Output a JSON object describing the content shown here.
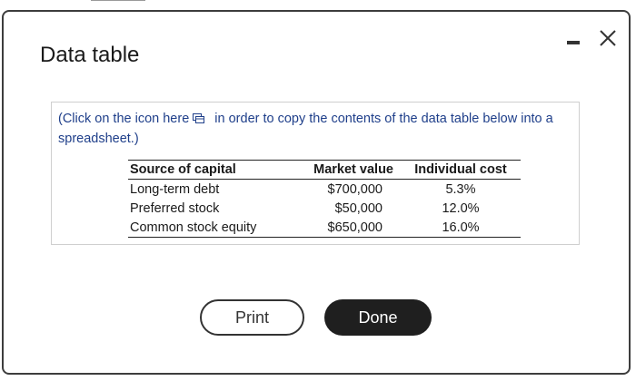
{
  "dialog": {
    "title": "Data table",
    "instructions_before_icon": "(Click on the icon  here",
    "instructions_after_icon": " in order to copy the contents of the data table below into a spreadsheet.)",
    "copy_icon": "copy-spreadsheet-icon",
    "window_controls": {
      "minimize": "minimize-icon",
      "close": "close-icon"
    }
  },
  "table": {
    "headers": [
      "Source of capital",
      "Market value",
      "Individual cost"
    ],
    "rows": [
      [
        "Long-term debt",
        "$700,000",
        "5.3%"
      ],
      [
        "Preferred stock",
        "$50,000",
        "12.0%"
      ],
      [
        "Common stock equity",
        "$650,000",
        "16.0%"
      ]
    ]
  },
  "buttons": {
    "print": "Print",
    "done": "Done"
  },
  "colors": {
    "instruction_text": "#1f3f8a",
    "done_button_bg": "#1f1f1f",
    "dialog_border": "#3d3d3d"
  }
}
